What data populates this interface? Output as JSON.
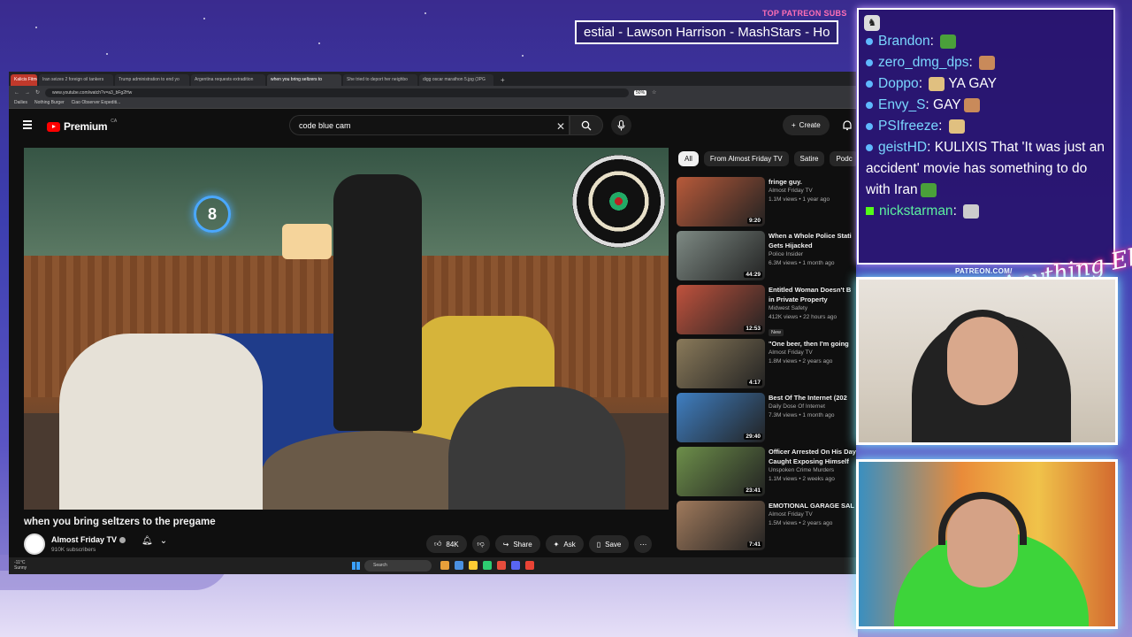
{
  "overlay": {
    "subs_title": "TOP PATREON SUBS",
    "subs_ticker": "estial - Lawson Harrison - MashStars - Ho",
    "patreon_label": "PATREON.COM/",
    "brand_logo": "Anything Else?"
  },
  "browser": {
    "tabs": [
      {
        "label": "Kalicis Fitmen"
      },
      {
        "label": "Iran seizes 2 foreign oil tankers"
      },
      {
        "label": "Trump administration to end yo"
      },
      {
        "label": "Argentina requests extradition"
      },
      {
        "label": "when you bring seltzers to",
        "active": true
      },
      {
        "label": "She tried to deport her neighbo"
      },
      {
        "label": "digg oscar marathon 5.jpg (3PG"
      }
    ],
    "url": "www.youtube.com/watch?v=a3_bFg2Hw",
    "zoom": "50%",
    "bookmarks": [
      "Dailies",
      "Nothing Burger",
      "Ciao Observer Expediti..."
    ]
  },
  "youtube": {
    "brand": "Premium",
    "region": "CA",
    "search_query": "code blue cam",
    "create_label": "Create",
    "video": {
      "title": "when you bring seltzers to the pregame",
      "channel": "Almost Friday TV",
      "subscribers": "910K subscribers",
      "likes": "84K",
      "share_label": "Share",
      "ask_label": "Ask",
      "save_label": "Save"
    },
    "chips": [
      "All",
      "From Almost Friday TV",
      "Satire",
      "Podc"
    ],
    "recommendations": [
      {
        "title": "fringe guy.",
        "title2": "",
        "channel": "Almost Friday TV",
        "meta": "1.1M views • 1 year ago",
        "duration": "9:20",
        "thumb": "#b85a3a"
      },
      {
        "title": "When a Whole Police Stati",
        "title2": "Gets Hijacked",
        "channel": "Police Insider",
        "meta": "6.3M views • 1 month ago",
        "duration": "44:29",
        "thumb": "#7e8a84"
      },
      {
        "title": "Entitled Woman Doesn't B",
        "title2": "in Private Property",
        "channel": "Midwest Safety",
        "meta": "412K views • 22 hours ago",
        "duration": "12:53",
        "thumb": "#c0523d",
        "badge": "New"
      },
      {
        "title": "\"One beer, then I'm going",
        "title2": "",
        "channel": "Almost Friday TV",
        "meta": "1.8M views • 2 years ago",
        "duration": "4:17",
        "thumb": "#8a7a5a"
      },
      {
        "title": "Best Of The Internet (202",
        "title2": "",
        "channel": "Daily Dose Of Internet",
        "meta": "7.3M views • 1 month ago",
        "duration": "29:40",
        "thumb": "#3f7fc2"
      },
      {
        "title": "Officer Arrested On His Day Off",
        "title2": "Caught Exposing Himself",
        "channel": "Unspoken Crime Murders",
        "meta": "1.1M views • 2 weeks ago",
        "duration": "23:41",
        "thumb": "#6d8f4a"
      },
      {
        "title": "EMOTIONAL GARAGE SAL",
        "title2": "",
        "channel": "Almost Friday TV",
        "meta": "1.5M views • 2 years ago",
        "duration": "7:41",
        "thumb": "#a07a5c"
      }
    ]
  },
  "taskbar": {
    "weather_temp": "-11°C",
    "weather_desc": "Sunny",
    "search_label": "Search"
  },
  "chat": {
    "messages": [
      {
        "user": "Brandon",
        "text": "",
        "emote": "#4aa03a"
      },
      {
        "user": "zero_dmg_dps",
        "text": "",
        "emote": "#c98a5a"
      },
      {
        "user": "Doppo",
        "text": "YA GAY",
        "emote": "#e0c080"
      },
      {
        "user": "Envy_S",
        "text": "GAY",
        "emote": "#c98a5a"
      },
      {
        "user": "PSIfreeze",
        "text": "",
        "emote": "#e0c080"
      },
      {
        "user": "geistHD",
        "text": "KULIXIS That 'It was just an accident' movie has something to do with Iran",
        "emote": "#4aa03a"
      },
      {
        "user": "nickstarman",
        "text": "",
        "emote": "#cccccc",
        "platform": "kick"
      }
    ]
  }
}
